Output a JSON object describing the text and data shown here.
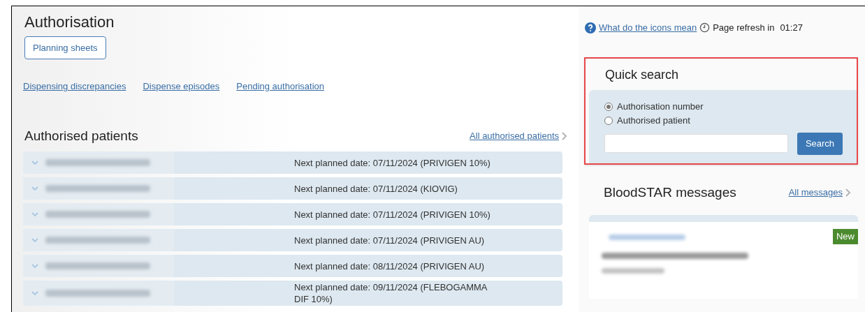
{
  "title": "Authorisation",
  "planning_button": "Planning sheets",
  "links": [
    "Dispensing discrepancies",
    "Dispense episodes",
    "Pending authorisation"
  ],
  "authorised_patients": {
    "title": "Authorised patients",
    "all_link": "All authorised patients",
    "rows": [
      {
        "next": "Next planned date: 07/11/2024 (PRIVIGEN 10%)"
      },
      {
        "next": "Next planned date: 07/11/2024 (KIOVIG)"
      },
      {
        "next": "Next planned date: 07/11/2024 (PRIVIGEN 10%)"
      },
      {
        "next": "Next planned date: 07/11/2024 (PRIVIGEN AU)"
      },
      {
        "next": "Next planned date: 08/11/2024 (PRIVIGEN AU)"
      },
      {
        "next": "Next planned date: 09/11/2024 (FLEBOGAMMA DIF 10%)"
      }
    ]
  },
  "help_link": "What do the icons mean",
  "refresh_label": "Page refresh in",
  "refresh_time": "01:27",
  "quick_search": {
    "title": "Quick search",
    "options": [
      {
        "label": "Authorisation number",
        "selected": true
      },
      {
        "label": "Authorised patient",
        "selected": false
      }
    ],
    "button": "Search"
  },
  "messages": {
    "title": "BloodSTAR messages",
    "all_link": "All messages",
    "items": [
      {
        "badge": "New"
      }
    ]
  }
}
